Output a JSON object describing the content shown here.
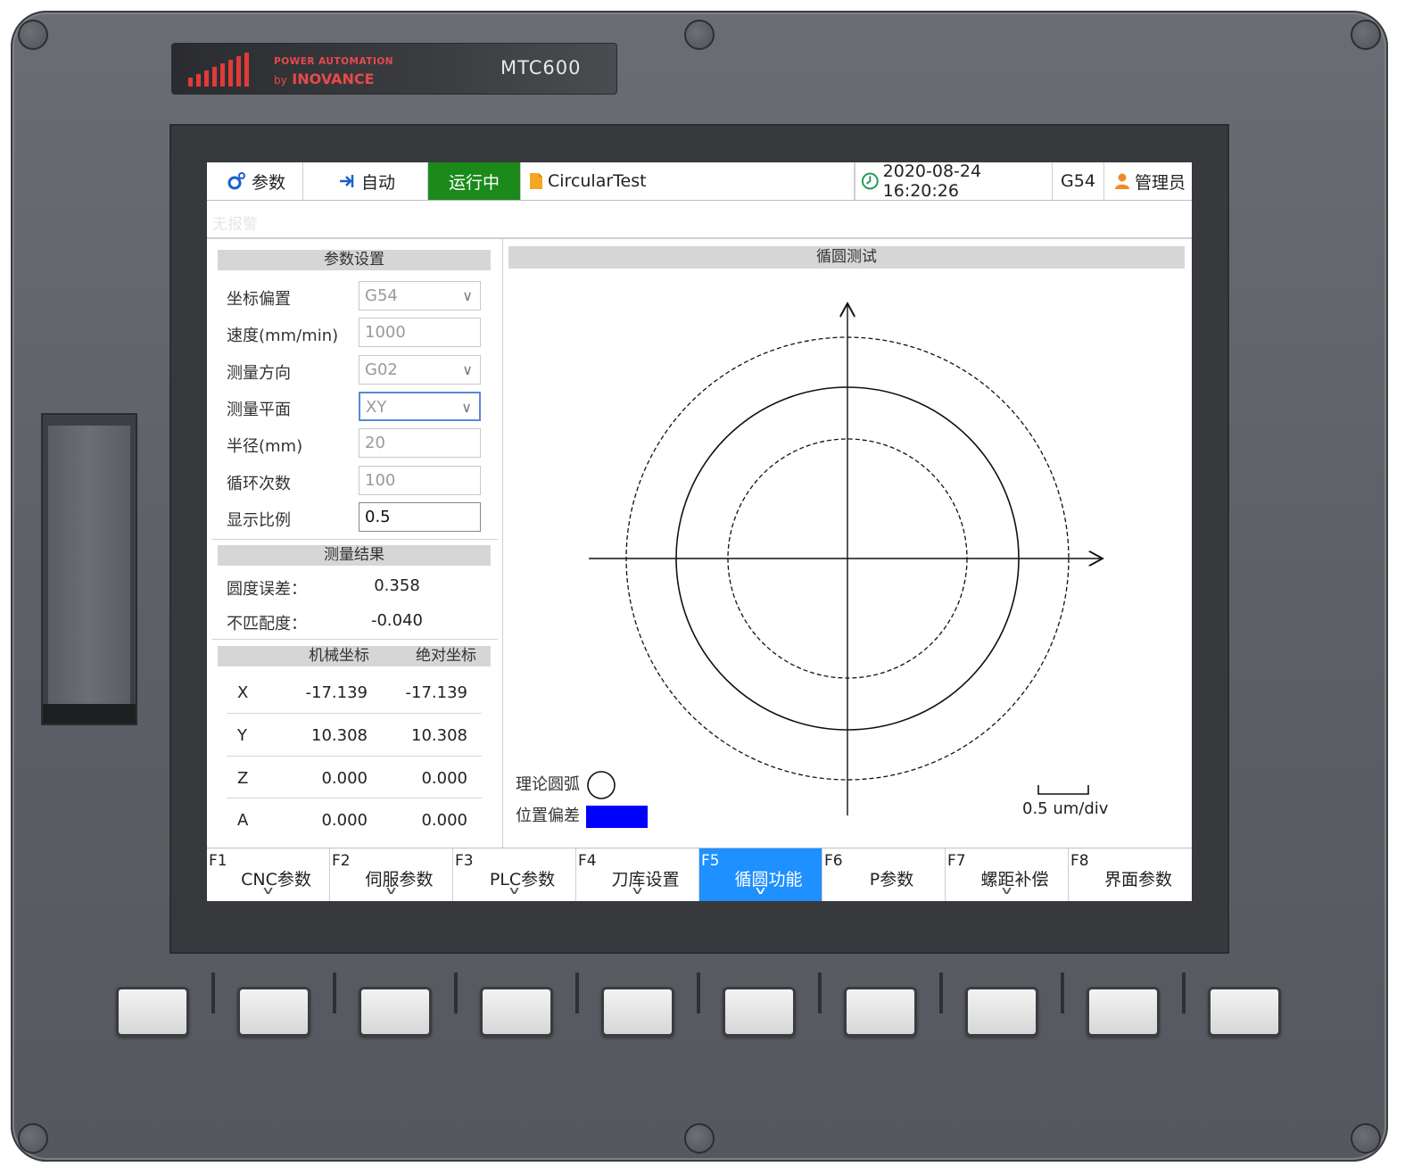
{
  "hardware": {
    "brand_line1": "POWER AUTOMATION",
    "brand_by": "by",
    "brand_name": "INOVANCE",
    "model": "MTC600"
  },
  "topbar": {
    "params_label": "参数",
    "auto_label": "自动",
    "status": "运行中",
    "program": "CircularTest",
    "datetime": "2020-08-24 16:20:26",
    "coord": "G54",
    "user": "管理员"
  },
  "alarm": "无报警",
  "params": {
    "header": "参数设置",
    "rows": [
      {
        "label": "坐标偏置",
        "value": "G54",
        "dropdown": true
      },
      {
        "label": "速度(mm/min)",
        "value": "1000"
      },
      {
        "label": "测量方向",
        "value": "G02",
        "dropdown": true
      },
      {
        "label": "测量平面",
        "value": "XY",
        "dropdown": true
      },
      {
        "label": "半径(mm)",
        "value": "20"
      },
      {
        "label": "循环次数",
        "value": "100"
      },
      {
        "label": "显示比例",
        "value": "0.5"
      }
    ]
  },
  "results": {
    "header": "测量结果",
    "roundness_label": "圆度误差：",
    "roundness_value": "0.358",
    "mismatch_label": "不匹配度：",
    "mismatch_value": "-0.040"
  },
  "coords": {
    "machine_header": "机械坐标",
    "absolute_header": "绝对坐标",
    "rows": [
      {
        "axis": "X",
        "machine": "-17.139",
        "absolute": "-17.139"
      },
      {
        "axis": "Y",
        "machine": "10.308",
        "absolute": "10.308"
      },
      {
        "axis": "Z",
        "machine": "0.000",
        "absolute": "0.000"
      },
      {
        "axis": "A",
        "machine": "0.000",
        "absolute": "0.000"
      }
    ]
  },
  "plot": {
    "title": "循圆测试",
    "legend_theory": "理论圆弧",
    "legend_deviation": "位置偏差",
    "deviation_color": "#0000ff",
    "scale_label": "0.5 um/div"
  },
  "fkeys": [
    {
      "key": "F1",
      "label": "CNC参数",
      "chevron": true
    },
    {
      "key": "F2",
      "label": "伺服参数",
      "chevron": true
    },
    {
      "key": "F3",
      "label": "PLC参数",
      "chevron": true
    },
    {
      "key": "F4",
      "label": "刀库设置",
      "chevron": true
    },
    {
      "key": "F5",
      "label": "循圆功能",
      "chevron": true,
      "active": true
    },
    {
      "key": "F6",
      "label": "P参数",
      "chevron": false
    },
    {
      "key": "F7",
      "label": "螺距补偿",
      "chevron": true
    },
    {
      "key": "F8",
      "label": "界面参数",
      "chevron": false
    }
  ],
  "colors": {
    "running": "#1b8a1b",
    "active_fkey": "#1e90ff"
  }
}
